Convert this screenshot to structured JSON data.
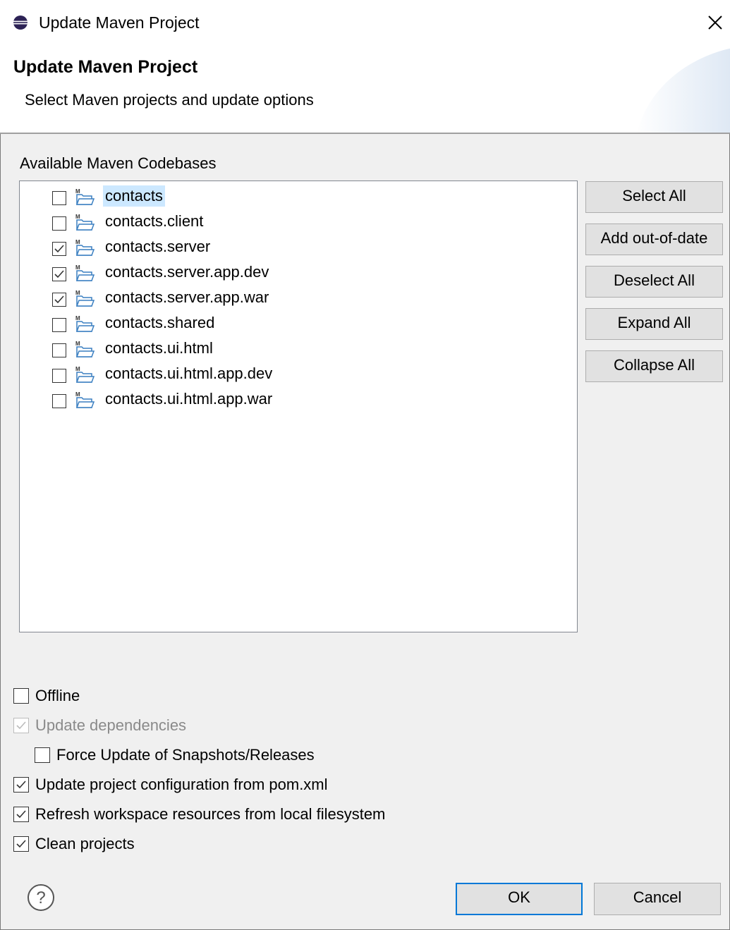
{
  "window": {
    "title": "Update Maven Project",
    "app_icon": "eclipse-icon",
    "close_icon": "close-icon",
    "close_glyph": "✕"
  },
  "banner": {
    "title": "Update Maven Project",
    "subtitle": "Select Maven projects and update options"
  },
  "codebases": {
    "label": "Available Maven Codebases",
    "items": [
      {
        "label": "contacts",
        "checked": false,
        "selected": true
      },
      {
        "label": "contacts.client",
        "checked": false,
        "selected": false
      },
      {
        "label": "contacts.server",
        "checked": true,
        "selected": false
      },
      {
        "label": "contacts.server.app.dev",
        "checked": true,
        "selected": false
      },
      {
        "label": "contacts.server.app.war",
        "checked": true,
        "selected": false
      },
      {
        "label": "contacts.shared",
        "checked": false,
        "selected": false
      },
      {
        "label": "contacts.ui.html",
        "checked": false,
        "selected": false
      },
      {
        "label": "contacts.ui.html.app.dev",
        "checked": false,
        "selected": false
      },
      {
        "label": "contacts.ui.html.app.war",
        "checked": false,
        "selected": false
      }
    ]
  },
  "side_buttons": {
    "select_all": "Select All",
    "add_out_of_date": "Add out-of-date",
    "deselect_all": "Deselect All",
    "expand_all": "Expand All",
    "collapse_all": "Collapse All"
  },
  "options": {
    "offline": {
      "label": "Offline",
      "checked": false,
      "enabled": true
    },
    "update_dependencies": {
      "label": "Update dependencies",
      "checked": true,
      "enabled": false
    },
    "force_update": {
      "label": "Force Update of Snapshots/Releases",
      "checked": false,
      "enabled": true
    },
    "update_config": {
      "label": "Update project configuration from pom.xml",
      "checked": true,
      "enabled": true
    },
    "refresh_workspace": {
      "label": "Refresh workspace resources from local filesystem",
      "checked": true,
      "enabled": true
    },
    "clean_projects": {
      "label": "Clean projects",
      "checked": true,
      "enabled": true
    }
  },
  "footer": {
    "help_icon": "help-icon",
    "ok_label": "OK",
    "cancel_label": "Cancel"
  },
  "colors": {
    "accent": "#0078d7",
    "selection": "#cce8ff",
    "folder": "#3a7fc1"
  }
}
